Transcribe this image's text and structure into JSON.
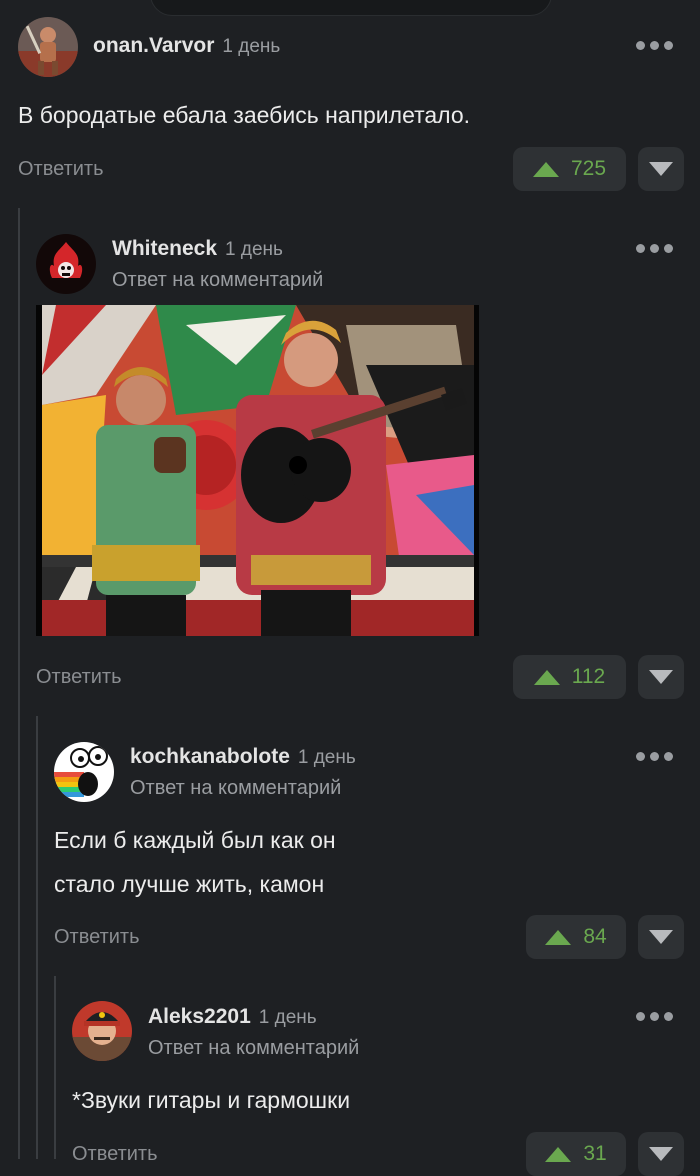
{
  "comments": [
    {
      "author": "onan.Varvor",
      "date": "1 день",
      "text_lines": [
        "В бородатые ебала заебись наприлетало."
      ],
      "reply_label": "Ответить",
      "votes": "725"
    },
    {
      "author": "Whiteneck",
      "date": "1 день",
      "reply_to": "Ответ на комментарий",
      "reply_label": "Ответить",
      "votes": "112"
    },
    {
      "author": "kochkanabolote",
      "date": "1 день",
      "reply_to": "Ответ на комментарий",
      "text_lines": [
        "Если б каждый был как он",
        "стало лучше жить, камон"
      ],
      "reply_label": "Ответить",
      "votes": "84"
    },
    {
      "author": "Aleks2201",
      "date": "1 день",
      "reply_to": "Ответ на комментарий",
      "text_lines": [
        "*Звуки гитары и гармошки"
      ],
      "reply_label": "Ответить",
      "votes": "31"
    }
  ],
  "icons": {
    "more": "more-dots-icon",
    "upvote": "upvote-arrow-icon",
    "downvote": "downvote-arrow-icon"
  },
  "colors": {
    "background": "#1e2023",
    "upvote": "#6aa84f",
    "muted": "#9a9da1"
  }
}
